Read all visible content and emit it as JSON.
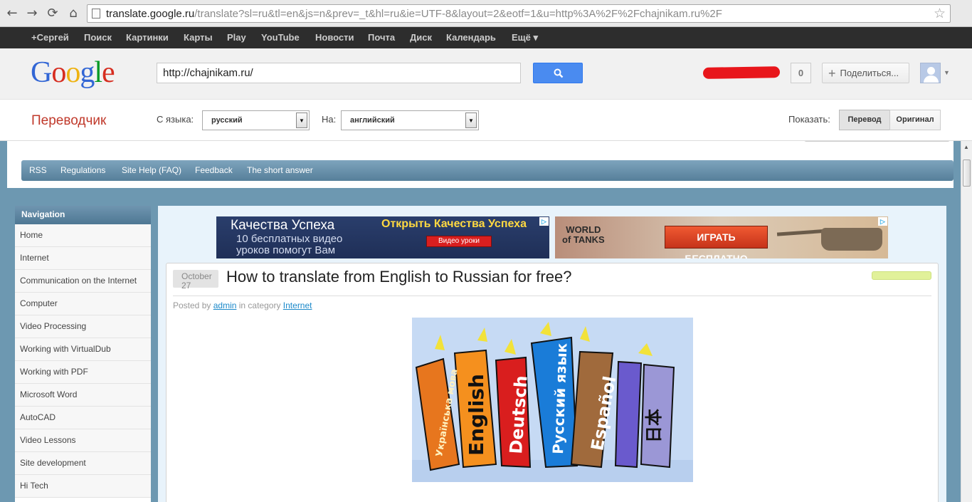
{
  "browser": {
    "url_host": "translate.google.ru",
    "url_rest": "/translate?sl=ru&tl=en&js=n&prev=_t&hl=ru&ie=UTF-8&layout=2&eotf=1&u=http%3A%2F%2Fchajnikam.ru%2F",
    "back_icon": "←",
    "forward_icon": "→",
    "reload_icon": "⟳",
    "home_icon": "⌂",
    "star_icon": "☆"
  },
  "gbar": {
    "items": [
      "+Сергей",
      "Поиск",
      "Картинки",
      "Карты",
      "Play",
      "YouTube",
      "Новости",
      "Почта",
      "Диск",
      "Календарь",
      "Ещё ▾"
    ]
  },
  "header": {
    "logo": [
      "G",
      "o",
      "o",
      "g",
      "l",
      "e"
    ],
    "search_value": "http://chajnikam.ru/",
    "notification_count": "0",
    "share_label": "Поделиться..."
  },
  "translator": {
    "title": "Переводчик",
    "from_label": "С языка:",
    "from_value": "русский",
    "to_label": "На:",
    "to_value": "английский",
    "show_label": "Показать:",
    "mode_translation": "Перевод",
    "mode_original": "Оригинал"
  },
  "site": {
    "menu": [
      "RSS",
      "Regulations",
      "Site Help (FAQ)",
      "Feedback",
      "The short answer"
    ],
    "nav_heading": "Navigation",
    "nav_items": [
      "Home",
      "Internet",
      "Communication on the Internet",
      "Computer",
      "Video Processing",
      "Working with VirtualDub",
      "Working with PDF",
      "Microsoft Word",
      "AutoCAD",
      "Video Lessons",
      "Site development",
      "Hi Tech"
    ],
    "ad1": {
      "title": "Качества Успеха",
      "line1": "10 бесплатных видео",
      "line2": "уроков помогут Вам",
      "cta": "Открыть Качества Успеха",
      "button": "Видео уроки"
    },
    "ad2": {
      "logo_line1": "WORLD",
      "logo_line2": "of TANKS",
      "button": "ИГРАТЬ БЕСПЛАТНО"
    },
    "post": {
      "date_month": "October",
      "date_day": "27",
      "title": "How to translate from English to Russian for free?",
      "posted_by": "Posted by",
      "author": "admin",
      "in_category": "in category",
      "category": "Internet",
      "book_labels": [
        "Українська мова",
        "English",
        "Deutsch",
        "Русский язык",
        "Español",
        "日本"
      ]
    }
  },
  "colors": {
    "gbar": "#2d2d2d",
    "search_button": "#4a8bf0",
    "translator_title": "#c0392b",
    "site_background": "#6d98b1",
    "link": "#1a88c9"
  }
}
